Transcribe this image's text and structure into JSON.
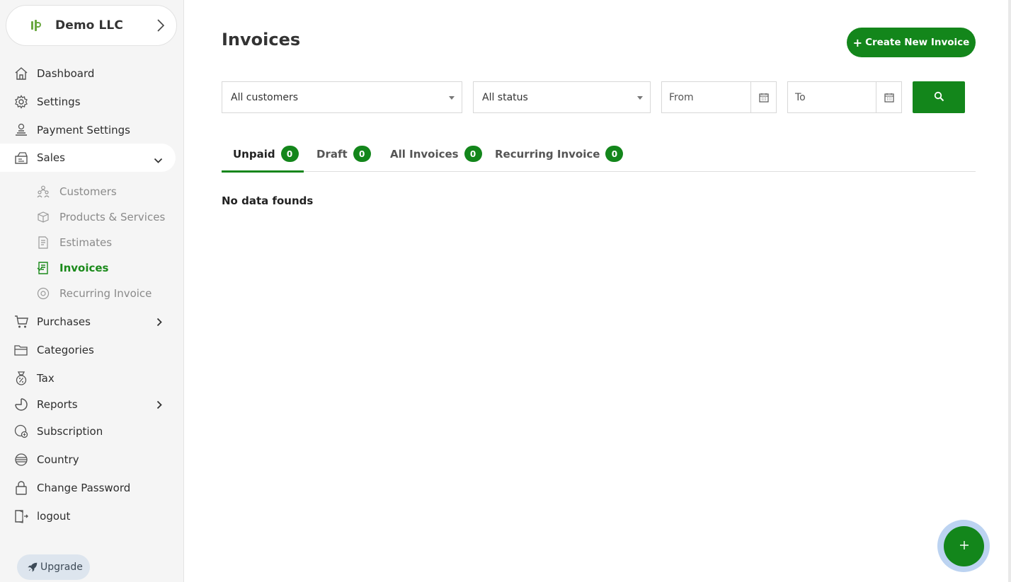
{
  "company": {
    "name": "Demo LLC"
  },
  "nav": {
    "dashboard": "Dashboard",
    "settings": "Settings",
    "payment_settings": "Payment Settings",
    "sales": "Sales",
    "purchases": "Purchases",
    "categories": "Categories",
    "tax": "Tax",
    "reports": "Reports",
    "subscription": "Subscription",
    "country": "Country",
    "change_password": "Change Password",
    "logout": "logout"
  },
  "sales_sub": {
    "customers": "Customers",
    "products_services": "Products & Services",
    "estimates": "Estimates",
    "invoices": "Invoices",
    "recurring_invoice": "Recurring Invoice"
  },
  "upgrade_label": "Upgrade",
  "page": {
    "title": "Invoices",
    "create_button": "Create New Invoice",
    "create_button_icon": "+"
  },
  "filters": {
    "customer": "All customers",
    "status": "All status",
    "from_placeholder": "From",
    "to_placeholder": "To"
  },
  "tabs": [
    {
      "label": "Unpaid",
      "count": "0",
      "active": true
    },
    {
      "label": "Draft",
      "count": "0",
      "active": false
    },
    {
      "label": "All Invoices",
      "count": "0",
      "active": false
    },
    {
      "label": "Recurring Invoice",
      "count": "0",
      "active": false
    }
  ],
  "empty_message": "No data founds",
  "fab_icon": "+",
  "colors": {
    "accent": "#13861b",
    "sidebar_bg": "#f5f5f5",
    "upgrade_bg": "#dde5ee",
    "fab_ring": "#bcd3f1"
  }
}
